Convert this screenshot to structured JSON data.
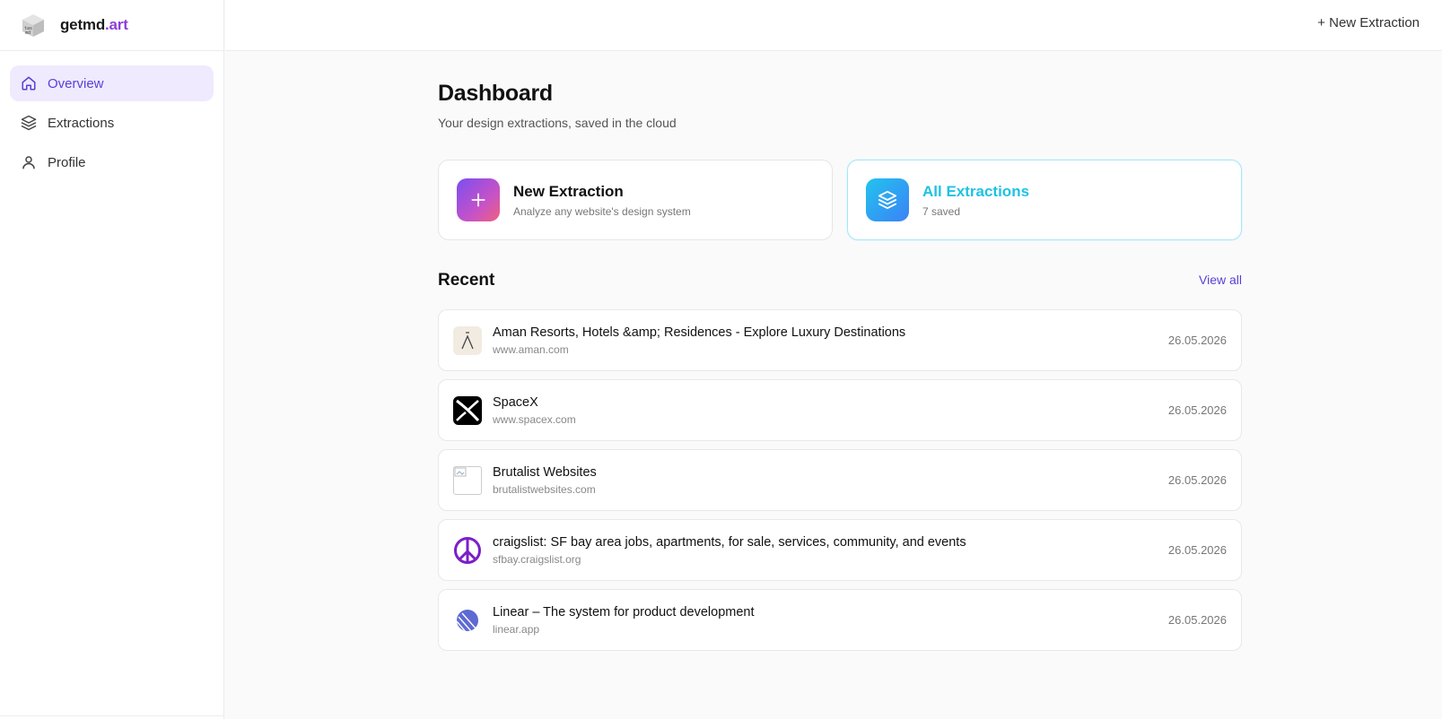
{
  "brand": {
    "name_main": "getmd",
    "name_accent": ".art",
    "logo_icon": "cube-logo-icon"
  },
  "nav": {
    "items": [
      {
        "label": "Overview",
        "icon": "home-icon",
        "active": true
      },
      {
        "label": "Extractions",
        "icon": "layers-icon",
        "active": false
      },
      {
        "label": "Profile",
        "icon": "user-icon",
        "active": false
      }
    ]
  },
  "topbar": {
    "new_extraction": "+ New Extraction"
  },
  "page": {
    "title": "Dashboard",
    "subtitle": "Your design extractions, saved in the cloud"
  },
  "cards": [
    {
      "title": "New Extraction",
      "subtitle": "Analyze any website's design system",
      "icon": "plus-icon"
    },
    {
      "title": "All Extractions",
      "subtitle": "7 saved",
      "icon": "layers-icon"
    }
  ],
  "recent": {
    "title": "Recent",
    "view_all": "View all",
    "items": [
      {
        "title": "Aman Resorts, Hotels &amp; Residences - Explore Luxury Destinations",
        "url": "www.aman.com",
        "date": "26.05.2026",
        "favicon": "aman-favicon"
      },
      {
        "title": "SpaceX",
        "url": "www.spacex.com",
        "date": "26.05.2026",
        "favicon": "spacex-favicon"
      },
      {
        "title": "Brutalist Websites",
        "url": "brutalistwebsites.com",
        "date": "26.05.2026",
        "favicon": "broken-image-favicon"
      },
      {
        "title": "craigslist: SF bay area jobs, apartments, for sale, services, community, and events",
        "url": "sfbay.craigslist.org",
        "date": "26.05.2026",
        "favicon": "peace-sign-favicon"
      },
      {
        "title": "Linear – The system for product development",
        "url": "linear.app",
        "date": "26.05.2026",
        "favicon": "linear-favicon"
      }
    ]
  },
  "colors": {
    "accent": "#5b3fd6",
    "brand_accent": "#8b3fd9",
    "cyan": "#1fc2e5",
    "active_bg": "#efeafd"
  }
}
